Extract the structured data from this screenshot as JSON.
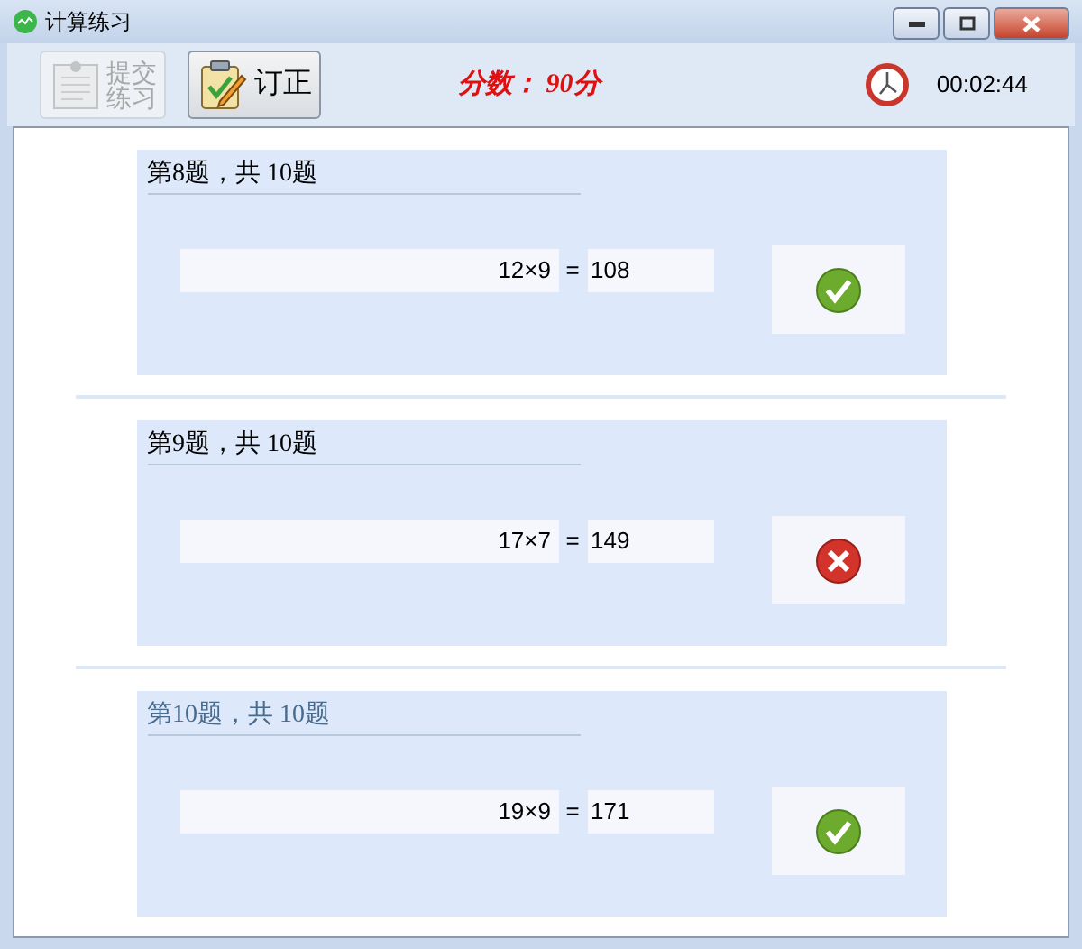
{
  "window": {
    "title": "计算练习"
  },
  "toolbar": {
    "buttons": [
      {
        "kind": "submit",
        "label": "提交练习",
        "disabled": true
      },
      {
        "kind": "correct",
        "label": "订正",
        "disabled": false
      }
    ],
    "score": "分数： 90分",
    "timer": "00:02:44"
  },
  "questions": [
    {
      "title": "第8题，共 10题",
      "current": false,
      "expression": "12×9",
      "equals": "=",
      "answer": "108",
      "correct": true
    },
    {
      "title": "第9题，共 10题",
      "current": false,
      "expression": "17×7",
      "equals": "=",
      "answer": "149",
      "correct": false
    },
    {
      "title": "第10题，共 10题",
      "current": true,
      "expression": "19×9",
      "equals": "=",
      "answer": "171",
      "correct": true
    }
  ]
}
